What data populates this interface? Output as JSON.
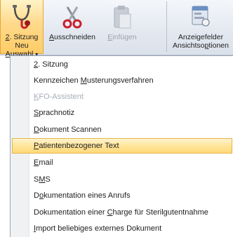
{
  "ribbon": {
    "sitzung_button": {
      "label_line1_pre": "2",
      "label_line1_post": ". Sitzung",
      "label_line2_pre": "Neu ",
      "label_line2_u": "A",
      "label_line2_post": "uswahl",
      "dropdown_glyph": "▾",
      "icon": "stethoscope-icon"
    },
    "cut_button": {
      "label_u": "A",
      "label_post": "usschneiden",
      "icon": "scissors-icon"
    },
    "paste_button": {
      "label_u": "E",
      "label_post": "infügen",
      "icon": "clipboard-icon"
    },
    "view_button": {
      "label_line1": "Anzeigefelder",
      "label_line2_pre": "Ansichtso",
      "label_line2_u": "p",
      "label_line2_post": "tionen",
      "icon": "view-options-icon"
    }
  },
  "menu": {
    "items": [
      {
        "pre": "",
        "u": "2",
        "post": ". Sitzung"
      },
      {
        "pre": "Kennzeichen ",
        "u": "M",
        "post": "usterungsverfahren"
      },
      {
        "pre": "",
        "u": "K",
        "post": "FO-Assistent"
      },
      {
        "pre": "",
        "u": "S",
        "post": "prachnotiz"
      },
      {
        "pre": "",
        "u": "D",
        "post": "okument Scannen"
      },
      {
        "pre": "",
        "u": "P",
        "post": "atientenbezogener Text"
      },
      {
        "pre": "",
        "u": "E",
        "post": "mail"
      },
      {
        "pre": "S",
        "u": "M",
        "post": "S"
      },
      {
        "pre": "D",
        "u": "o",
        "post": "kumentation eines Anrufs"
      },
      {
        "pre": "Dokumentation einer ",
        "u": "C",
        "post": "harge für Sterilgutentnahme"
      },
      {
        "pre": "",
        "u": "I",
        "post": "mport beliebiges externes Dokument"
      }
    ]
  },
  "colors": {
    "accent": "#ffd978",
    "disabled_text": "#a7adb5",
    "ribbon_bg": "#e3e8f0"
  }
}
